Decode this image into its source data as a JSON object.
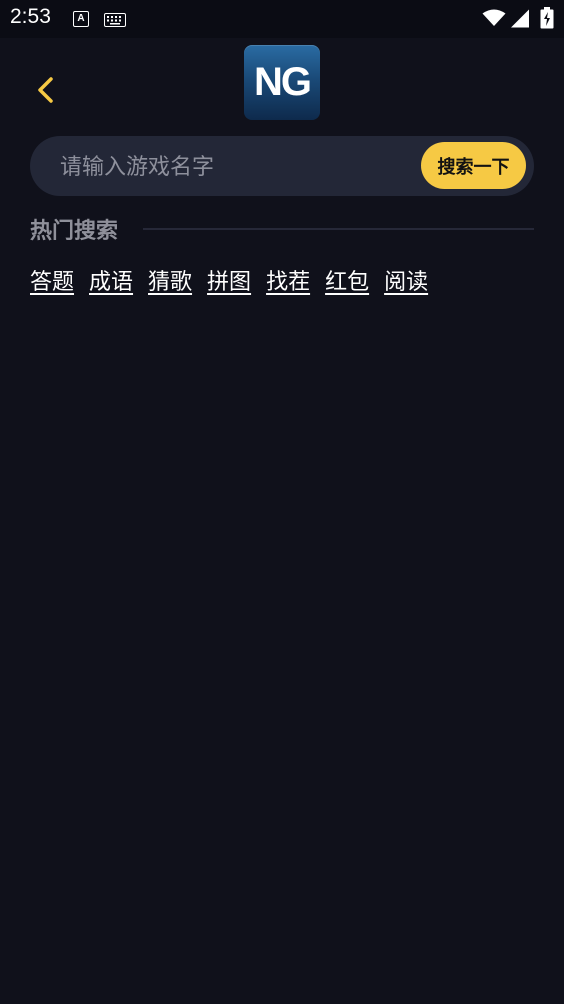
{
  "status_bar": {
    "time": "2:53",
    "a_icon_label": "A",
    "icons": [
      "a-notification-icon",
      "keyboard-icon",
      "wifi-icon",
      "signal-icon",
      "battery-icon"
    ]
  },
  "header": {
    "back_icon": "chevron-left-icon",
    "logo_text": "NG"
  },
  "search": {
    "placeholder": "请输入游戏名字",
    "value": "",
    "button_label": "搜索一下"
  },
  "hot_search": {
    "title": "热门搜索",
    "tags": [
      "答题",
      "成语",
      "猜歌",
      "拼图",
      "找茬",
      "红包",
      "阅读"
    ]
  },
  "colors": {
    "background": "#10111b",
    "accent": "#f6c944",
    "search_bg": "#232737",
    "muted_text": "#8f909a"
  }
}
